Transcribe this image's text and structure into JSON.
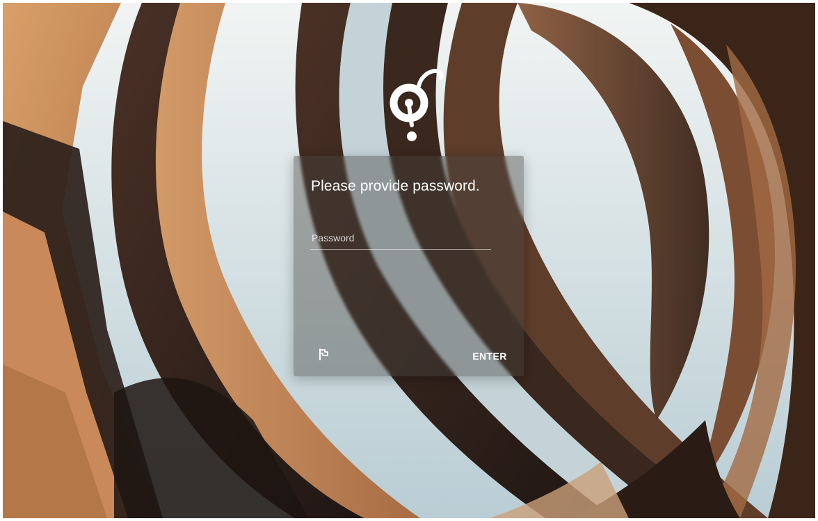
{
  "background": {
    "description_colors": {
      "sky": "#d7e3e6",
      "wood_dark": "#2a1d17",
      "wood_mid": "#6b4833",
      "wood_light": "#c98c5b",
      "floor": "#b97946"
    }
  },
  "logo": {
    "icon": "keyhole-logo-icon",
    "color": "#ffffff"
  },
  "dialog": {
    "title": "Please provide password.",
    "password": {
      "placeholder": "Password",
      "value": ""
    },
    "flag_icon": "flag-icon",
    "enter_label": "ENTER"
  }
}
